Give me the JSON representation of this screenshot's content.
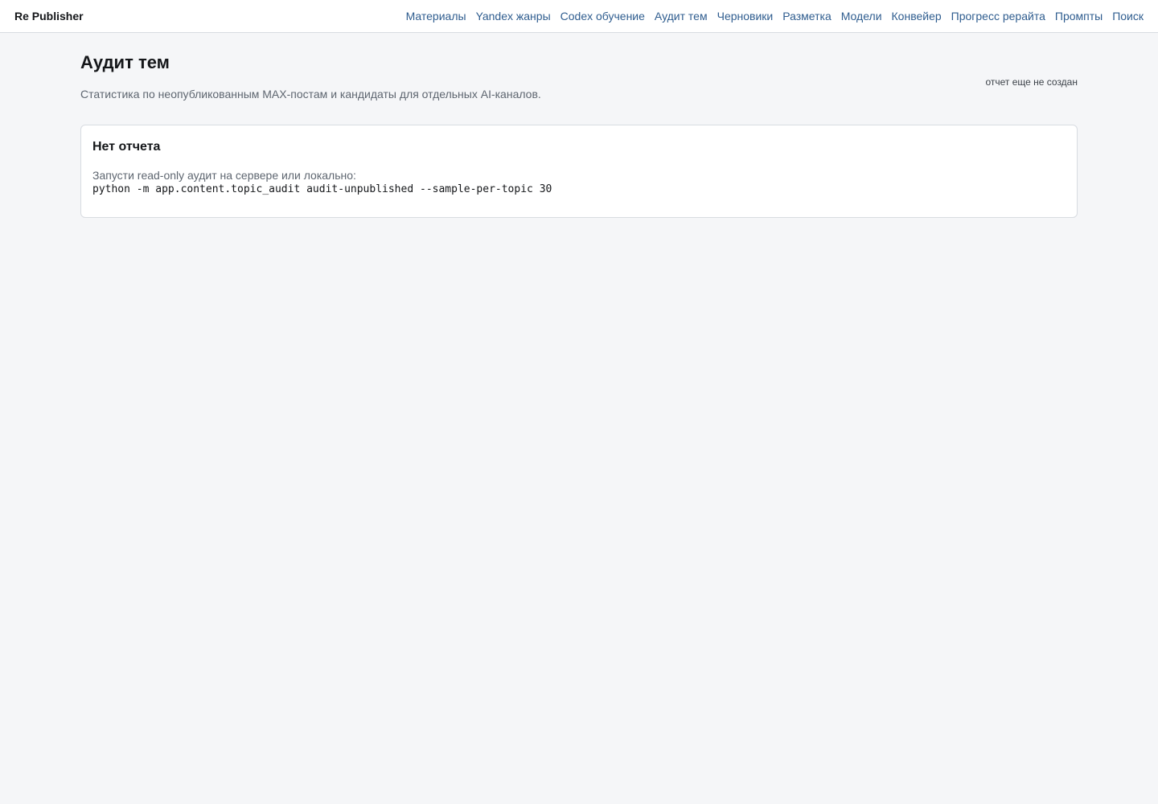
{
  "header": {
    "brand": "Re Publisher",
    "nav": [
      "Материалы",
      "Yandex жанры",
      "Codex обучение",
      "Аудит тем",
      "Черновики",
      "Разметка",
      "Модели",
      "Конвейер",
      "Прогресс рерайта",
      "Промпты",
      "Поиск"
    ]
  },
  "page": {
    "title": "Аудит тем",
    "subtitle": "Статистика по неопубликованным MAX-постам и кандидаты для отдельных AI-каналов.",
    "report_status": "отчет еще не создан"
  },
  "card": {
    "title": "Нет отчета",
    "text": "Запусти read-only аудит на сервере или локально:",
    "command": "python -m app.content.topic_audit audit-unpublished --sample-per-topic 30"
  },
  "colors": {
    "link": "#2f5d8f",
    "background": "#f5f6f8"
  }
}
